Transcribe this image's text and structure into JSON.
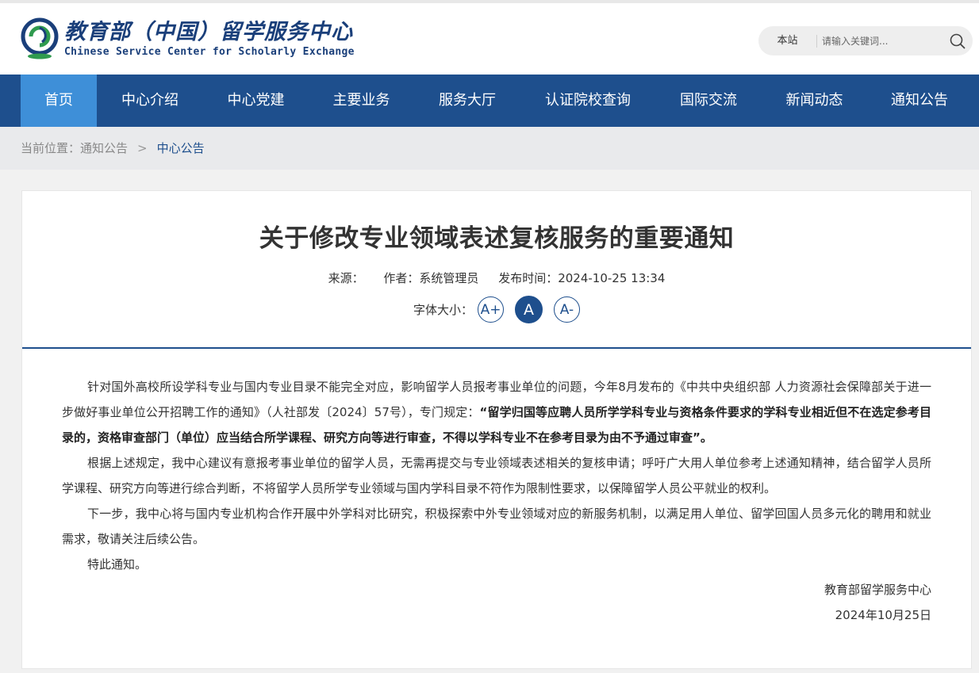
{
  "site": {
    "title_cn": "教育部（中国）留学服务中心",
    "title_en": "Chinese Service Center for Scholarly Exchange"
  },
  "search": {
    "scope_label": "本站",
    "placeholder": "请输入关键词..."
  },
  "nav": {
    "items": [
      {
        "label": "首页"
      },
      {
        "label": "中心介绍"
      },
      {
        "label": "中心党建"
      },
      {
        "label": "主要业务"
      },
      {
        "label": "服务大厅"
      },
      {
        "label": "认证院校查询"
      },
      {
        "label": "国际交流"
      },
      {
        "label": "新闻动态"
      },
      {
        "label": "通知公告"
      }
    ]
  },
  "breadcrumb": {
    "prefix": "当前位置：",
    "parent": "通知公告",
    "separator": ">",
    "current": "中心公告"
  },
  "article": {
    "title": "关于修改专业领域表述复核服务的重要通知",
    "source_label": "来源：",
    "author_label": "作者：系统管理员",
    "publish_label": "发布时间：2024-10-25 13:34",
    "font_size_label": "字体大小：",
    "font_buttons": [
      "A+",
      "A",
      "A-"
    ],
    "p1_plain": "针对国外高校所设学科专业与国内专业目录不能完全对应，影响留学人员报考事业单位的问题，今年8月发布的《中共中央组织部 人力资源社会保障部关于进一步做好事业单位公开招聘工作的通知》（人社部发〔2024〕57号），专门规定：",
    "p1_bold": "“留学归国等应聘人员所学学科专业与资格条件要求的学科专业相近但不在选定参考目录的，资格审查部门（单位）应当结合所学课程、研究方向等进行审查，不得以学科专业不在参考目录为由不予通过审查”。",
    "p2": "根据上述规定，我中心建议有意报考事业单位的留学人员，无需再提交与专业领域表述相关的复核申请；呼吁广大用人单位参考上述通知精神，结合留学人员所学课程、研究方向等进行综合判断，不将留学人员所学专业领域与国内学科目录不符作为限制性要求，以保障留学人员公平就业的权利。",
    "p3": "下一步，我中心将与国内专业机构合作开展中外学科对比研究，积极探索中外专业领域对应的新服务机制，以满足用人单位、留学回国人员多元化的聘用和就业需求，敬请关注后续公告。",
    "p4": "特此通知。",
    "sign_org": "教育部留学服务中心",
    "sign_date": "2024年10月25日"
  },
  "colors": {
    "nav_bg": "#1e4f8d",
    "nav_active": "#3e8fd8",
    "accent": "#1e4f8d"
  }
}
